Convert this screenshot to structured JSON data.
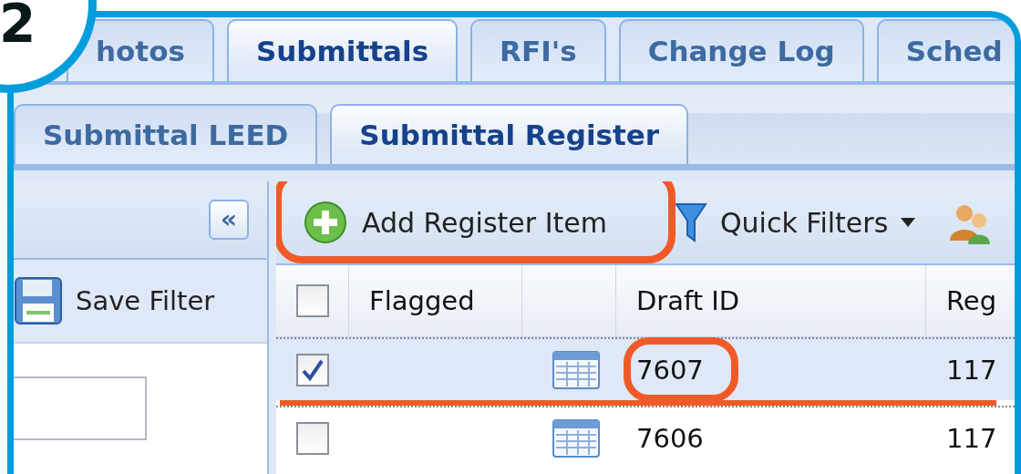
{
  "step_badge": {
    "label": "2"
  },
  "main_tabs": [
    {
      "label": "hotos",
      "selected": false
    },
    {
      "label": "Submittals",
      "selected": true
    },
    {
      "label": "RFI's",
      "selected": false
    },
    {
      "label": "Change Log",
      "selected": false
    },
    {
      "label": "Sched",
      "selected": false
    }
  ],
  "sub_tabs": [
    {
      "label": "Submittal LEED",
      "selected": false
    },
    {
      "label": "Submittal Register",
      "selected": true
    }
  ],
  "filter_panel": {
    "collapse": "«",
    "save_filter": "Save Filter"
  },
  "toolbar": {
    "add_button": {
      "label": "Add Register Item",
      "highlighted": true
    },
    "quick_filters": {
      "label": "Quick Filters",
      "dropdown": true
    }
  },
  "grid": {
    "header_checked": false,
    "columns": [
      "Flagged",
      "Draft ID",
      "Reg"
    ],
    "rows": [
      {
        "checked": true,
        "selected": true,
        "draft_id": "7607",
        "reg": "117",
        "circled": true,
        "underlined": true
      },
      {
        "checked": false,
        "selected": false,
        "draft_id": "7606",
        "reg": "117",
        "circled": false,
        "underlined": false
      }
    ]
  }
}
